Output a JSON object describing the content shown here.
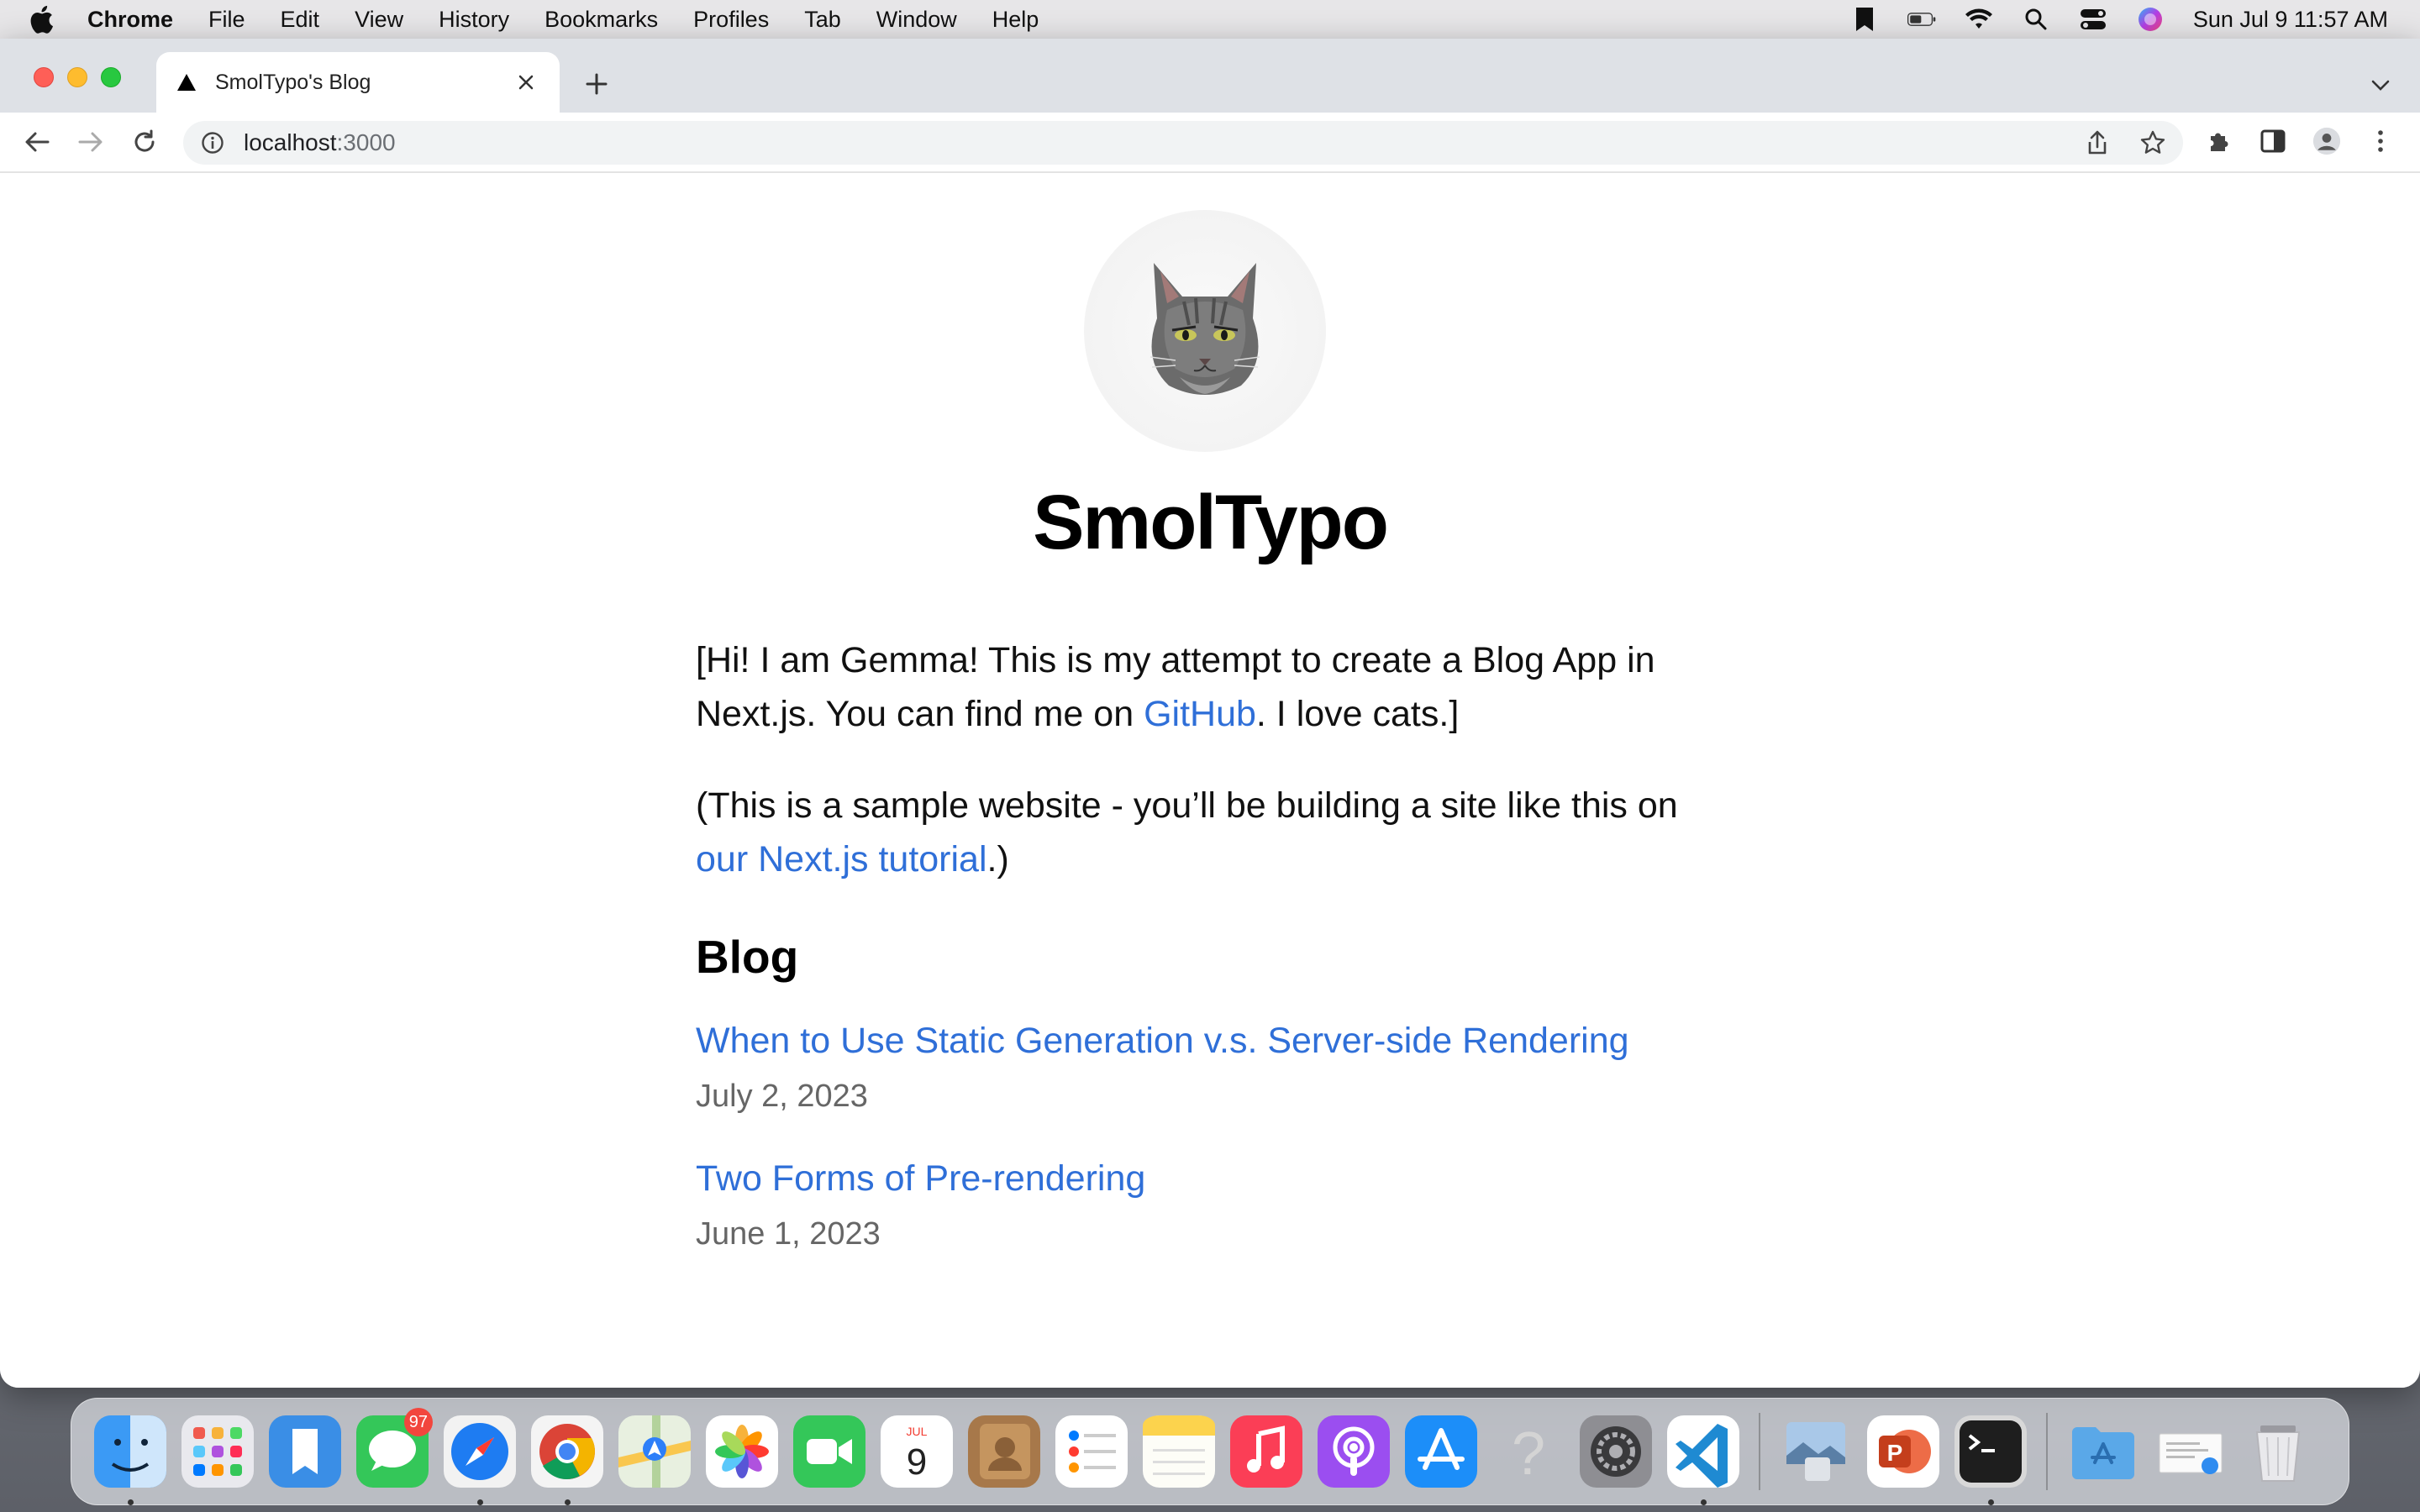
{
  "menubar": {
    "app_name": "Chrome",
    "menus": [
      "File",
      "Edit",
      "View",
      "History",
      "Bookmarks",
      "Profiles",
      "Tab",
      "Window",
      "Help"
    ],
    "datetime": "Sun Jul 9  11:57 AM"
  },
  "browser": {
    "tab_title": "SmolTypo's Blog",
    "url_host": "localhost",
    "url_port": ":3000"
  },
  "page": {
    "site_title": "SmolTypo",
    "intro_prefix": "[Hi! I am Gemma! This is my attempt to create a Blog App in Next.js. You can find me on ",
    "intro_link": "GitHub",
    "intro_suffix": ". I love cats.]",
    "sample_prefix": "(This is a sample website - you’ll be building a site like this on ",
    "sample_link": "our Next.js tutorial",
    "sample_suffix": ".)",
    "blog_heading": "Blog",
    "posts": [
      {
        "title": "When to Use Static Generation v.s. Server-side Rendering",
        "date": "July 2, 2023"
      },
      {
        "title": "Two Forms of Pre-rendering",
        "date": "June 1, 2023"
      }
    ]
  },
  "dock": {
    "messages_badge": "97",
    "calendar_month": "JUL",
    "calendar_day": "9"
  },
  "colors": {
    "link": "#2f6fd8",
    "tab_strip": "#dee1e6"
  }
}
